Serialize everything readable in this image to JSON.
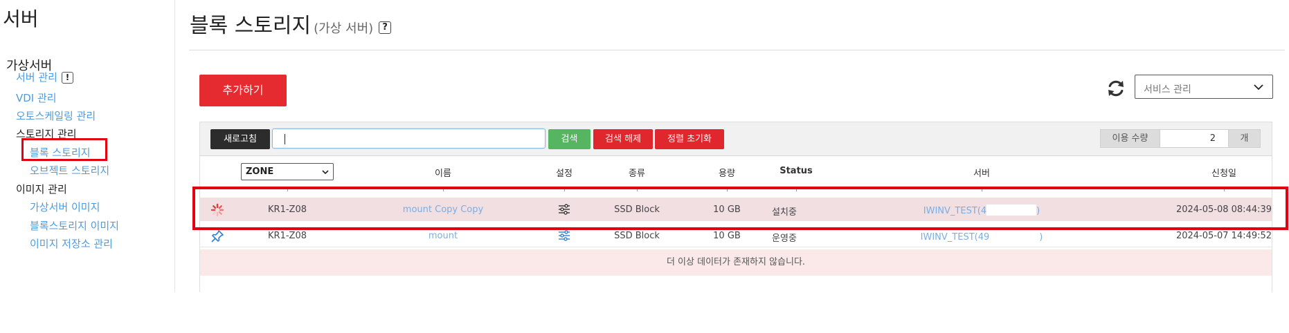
{
  "sidebar": {
    "title": "서버",
    "group_title": "가상서버",
    "server_mgmt_label": "서버 관리",
    "server_mgmt_badge": "!",
    "vdi_label": "VDI 관리",
    "autoscaling_label": "오토스케일링 관리",
    "storage_heading": "스토리지 관리",
    "block_storage_label": "블록 스토리지",
    "object_storage_label": "오브젝트 스토리지",
    "image_heading": "이미지 관리",
    "vm_image_label": "가상서버 이미지",
    "block_image_label": "블록스토리지 이미지",
    "image_repo_label": "이미지 저장소 관리"
  },
  "header": {
    "title": "블록 스토리지",
    "subtitle": "(가상 서버)",
    "help_badge": "?",
    "add_button_label": "추가하기",
    "service_select_value": "서비스 관리"
  },
  "toolbar": {
    "reload_label": "새로고침",
    "search_value": "",
    "search_label": "검색",
    "clear_label": "검색 해제",
    "sort_reset_label": "정렬 초기화",
    "qty_label": "이용 수량",
    "qty_value": "2",
    "qty_unit": "개"
  },
  "table": {
    "zone_filter_value": "ZONE",
    "headers": {
      "name": "이름",
      "settings": "설정",
      "type": "종류",
      "size": "용량",
      "status": "Status",
      "server": "서버",
      "requested": "신청일"
    },
    "rows": [
      {
        "zone": "KR1-Z08",
        "name": "mount Copy Copy",
        "type": "SSD Block",
        "size": "10 GB",
        "status": "설치중",
        "server_prefix": "IWINV_TEST(4",
        "server_suffix": ")",
        "requested": "2024-05-08 08:44:39",
        "icon": "spinner-icon"
      },
      {
        "zone": "KR1-Z08",
        "name": "mount",
        "type": "SSD Block",
        "size": "10 GB",
        "status": "운영중",
        "server_prefix": "IWINV_TEST(49",
        "server_suffix": ")",
        "requested": "2024-05-07 14:49:52",
        "icon": "pin-icon"
      }
    ],
    "empty_message": "더 이상 데이터가 존재하지 않습니다."
  },
  "colors": {
    "accent_red": "#e52a30",
    "search_green": "#55b560",
    "link_blue": "#4d9be0",
    "highlight_row": "#f2dfe1",
    "annotation_red": "#e3000f"
  }
}
